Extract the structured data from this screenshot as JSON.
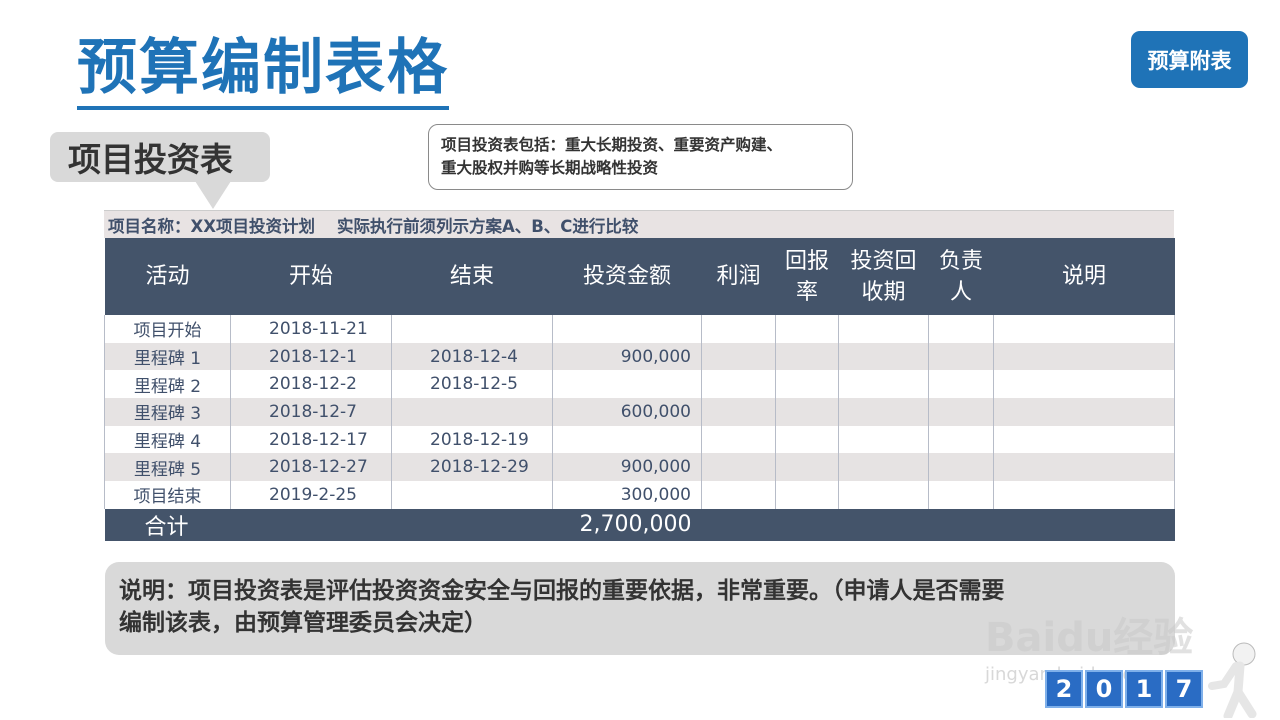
{
  "title": "预算编制表格",
  "tag_button": "预算附表",
  "callout": "项目投资表",
  "note": {
    "line1": "项目投资表包括：重大长期投资、重要资产购建、",
    "line2": "重大股权并购等长期战略性投资"
  },
  "project_name": {
    "label": "项目名称：XX项目投资计划",
    "remark": "实际执行前须列示方案A、B、C进行比较"
  },
  "table": {
    "headers": [
      {
        "line1": "活动",
        "line2": ""
      },
      {
        "line1": "开始",
        "line2": ""
      },
      {
        "line1": "结束",
        "line2": ""
      },
      {
        "line1": "投资金额",
        "line2": ""
      },
      {
        "line1": "利润",
        "line2": ""
      },
      {
        "line1": "回报",
        "line2": "率"
      },
      {
        "line1": "投资回",
        "line2": "收期"
      },
      {
        "line1": "负责",
        "line2": "人"
      },
      {
        "line1": "说明",
        "line2": ""
      }
    ],
    "rows": [
      {
        "activity": "项目开始",
        "start": "2018-11-21",
        "end": "",
        "amount": ""
      },
      {
        "activity": "里程碑 1",
        "start": "2018-12-1",
        "end": "2018-12-4",
        "amount": "900,000"
      },
      {
        "activity": "里程碑 2",
        "start": "2018-12-2",
        "end": "2018-12-5",
        "amount": ""
      },
      {
        "activity": "里程碑 3",
        "start": "2018-12-7",
        "end": "",
        "amount": "600,000"
      },
      {
        "activity": "里程碑 4",
        "start": "2018-12-17",
        "end": "2018-12-19",
        "amount": ""
      },
      {
        "activity": "里程碑 5",
        "start": "2018-12-27",
        "end": "2018-12-29",
        "amount": "900,000"
      },
      {
        "activity": "项目结束",
        "start": "2019-2-25",
        "end": "",
        "amount": "300,000"
      }
    ],
    "total": {
      "label": "合计",
      "amount": "2,700,000"
    }
  },
  "description": {
    "line1": "说明：项目投资表是评估投资资金安全与回报的重要依据，非常重要。（申请人是否需要",
    "line2": "编制该表，由预算管理委员会决定）"
  },
  "watermark": {
    "logo": "Baidu经验",
    "url": "jingyan.baidu.com",
    "year_digits": [
      "2",
      "0",
      "1",
      "7"
    ]
  }
}
